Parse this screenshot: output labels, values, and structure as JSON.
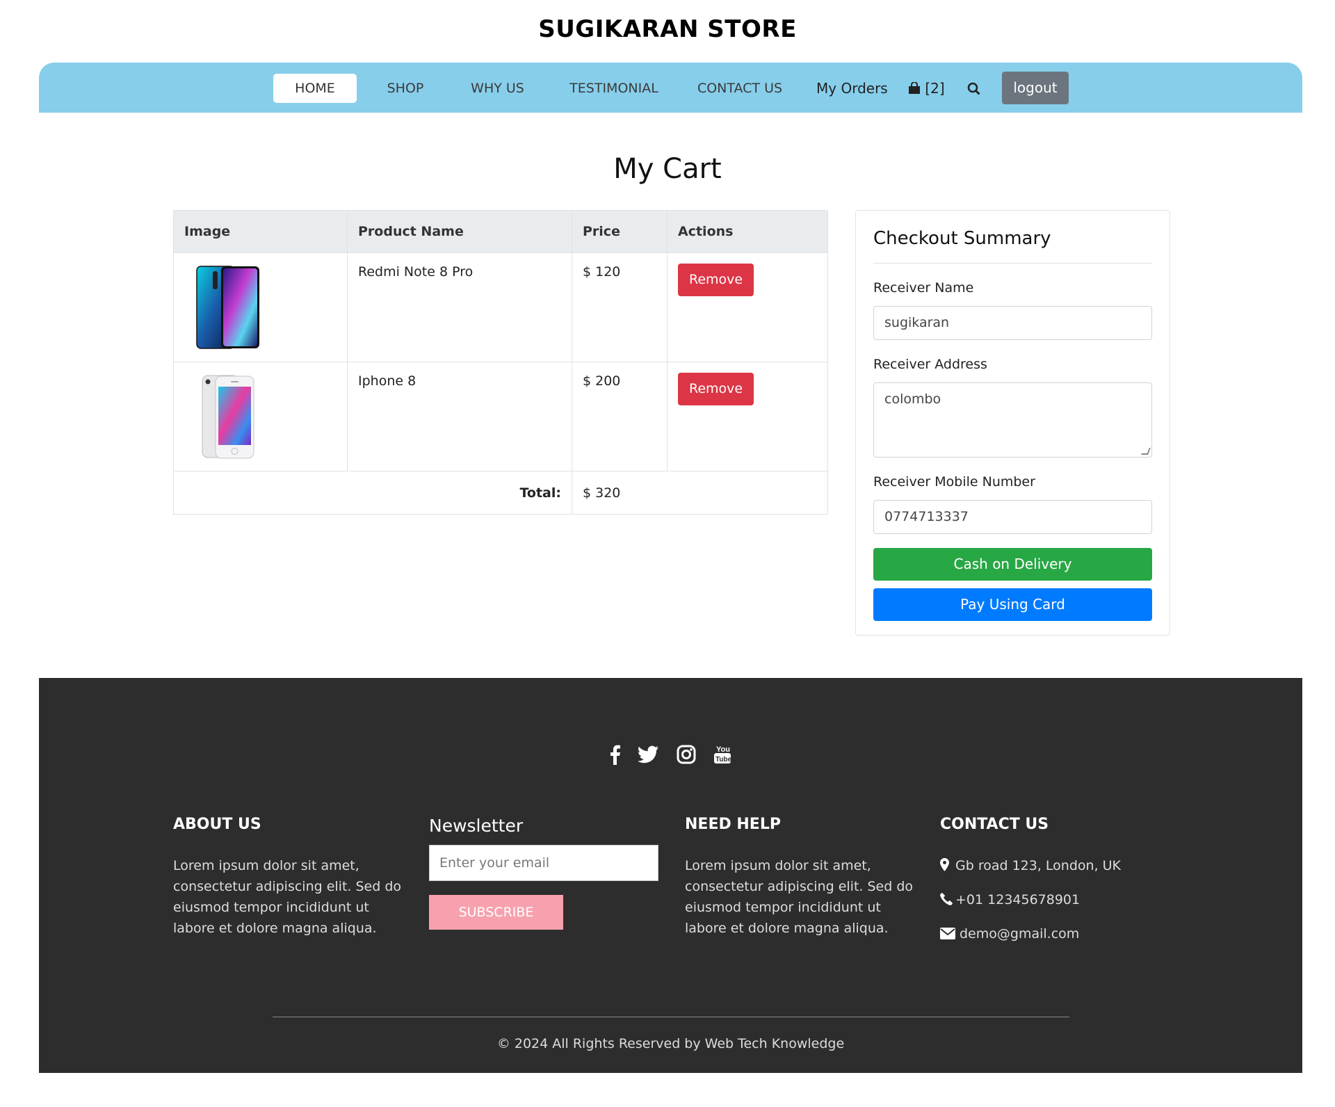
{
  "store": {
    "title": "SUGIKARAN STORE"
  },
  "nav": {
    "links": [
      "HOME",
      "SHOP",
      "WHY US",
      "TESTIMONIAL",
      "CONTACT US"
    ],
    "my_orders": "My Orders",
    "cart_count": "[2]",
    "logout": "logout"
  },
  "cart": {
    "heading": "My Cart",
    "columns": [
      "Image",
      "Product Name",
      "Price",
      "Actions"
    ],
    "items": [
      {
        "name": "Redmi Note 8 Pro",
        "price": "$ 120",
        "action": "Remove"
      },
      {
        "name": "Iphone 8",
        "price": "$ 200",
        "action": "Remove"
      }
    ],
    "total_label": "Total:",
    "total_value": "$ 320"
  },
  "summary": {
    "title": "Checkout Summary",
    "receiver_name_label": "Receiver Name",
    "receiver_name_value": "sugikaran",
    "receiver_address_label": "Receiver Address",
    "receiver_address_value": "colombo",
    "receiver_mobile_label": "Receiver Mobile Number",
    "receiver_mobile_value": "0774713337",
    "cod_button": "Cash on Delivery",
    "card_button": "Pay Using Card"
  },
  "footer": {
    "social_icons": [
      "facebook-icon",
      "twitter-icon",
      "instagram-icon",
      "youtube-icon"
    ],
    "about_title": "ABOUT US",
    "about_text": "Lorem ipsum dolor sit amet, consectetur adipiscing elit. Sed do eiusmod tempor incididunt ut labore et dolore magna aliqua.",
    "newsletter_title": "Newsletter",
    "email_placeholder": "Enter your email",
    "subscribe_button": "SUBSCRIBE",
    "help_title": "NEED HELP",
    "help_text": "Lorem ipsum dolor sit amet, consectetur adipiscing elit. Sed do eiusmod tempor incididunt ut labore et dolore magna aliqua.",
    "contact_title": "CONTACT US",
    "address": "Gb road 123, London, UK",
    "phone": "+01 12345678901",
    "email": "demo@gmail.com",
    "copyright": "© 2024 All Rights Reserved by Web Tech Knowledge"
  },
  "colors": {
    "navbar": "#87ceeb",
    "remove": "#dc3545",
    "cod": "#28a745",
    "card": "#007bff",
    "footer": "#2d2d2d",
    "subscribe": "#f7a1ae",
    "logout": "#6c757d"
  }
}
